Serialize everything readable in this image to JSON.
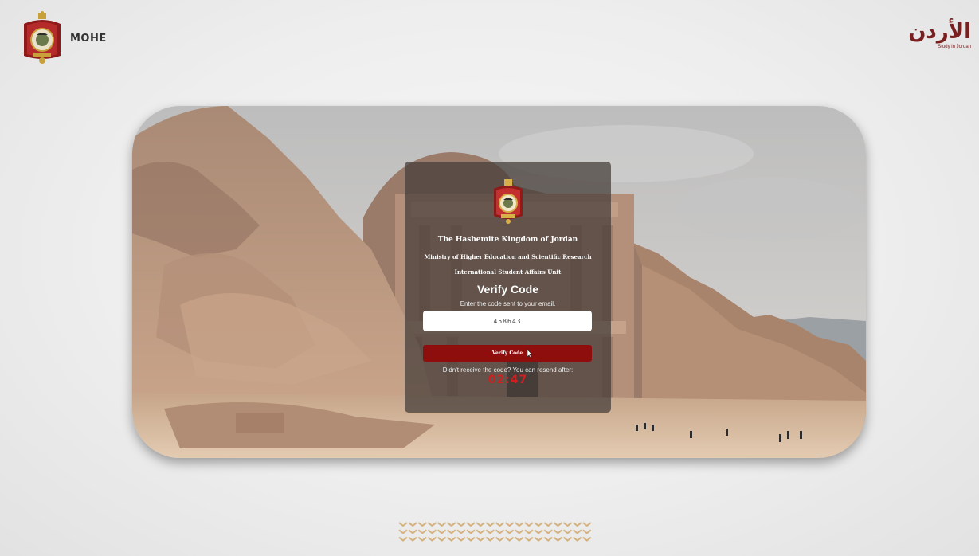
{
  "header": {
    "org_short": "MOHE",
    "logo_text_ar": "الأردن",
    "logo_text_en": "Study in Jordan"
  },
  "card": {
    "kingdom": "The Hashemite Kingdom of Jordan",
    "ministry": "Ministry of Higher Education and Scientific Research",
    "unit": "International Student Affairs Unit",
    "heading": "Verify Code",
    "instruction": "Enter the code sent to your email.",
    "code_value": "458643",
    "verify_label": "Verify Code",
    "resend_text": "Didn't receive the code? You can resend after:",
    "timer": "02:47"
  },
  "colors": {
    "accent": "#8e0d0d",
    "timer": "#d21e1e",
    "brand_gold": "#a0782a"
  },
  "icons": {
    "crest": "jordan-coat-of-arms-icon",
    "cursor": "mouse-pointer-icon"
  }
}
